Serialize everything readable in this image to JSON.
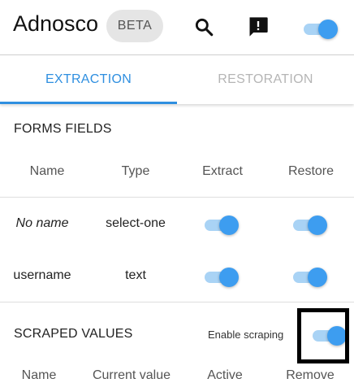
{
  "header": {
    "app_title": "Adnosco",
    "beta_label": "BETA",
    "search_icon": "search-icon",
    "feedback_icon": "feedback-icon",
    "master_toggle_on": true
  },
  "tabs": [
    {
      "label": "EXTRACTION",
      "active": true
    },
    {
      "label": "RESTORATION",
      "active": false
    }
  ],
  "forms_fields": {
    "title": "FORMS FIELDS",
    "columns": [
      "Name",
      "Type",
      "Extract",
      "Restore"
    ],
    "rows": [
      {
        "name": "No name",
        "type": "select-one",
        "extract": true,
        "restore": true
      },
      {
        "name": "username",
        "type": "text",
        "extract": true,
        "restore": true
      }
    ]
  },
  "scraped_values": {
    "title": "SCRAPED VALUES",
    "enable_label": "Enable scraping",
    "enabled": true,
    "columns": [
      "Name",
      "Current value",
      "Active",
      "Remove"
    ]
  },
  "colors": {
    "accent": "#2f8fe0",
    "toggle_thumb": "#3d9df0",
    "toggle_track": "#a9d3f5",
    "inactive_tab": "#b5b5b5"
  }
}
